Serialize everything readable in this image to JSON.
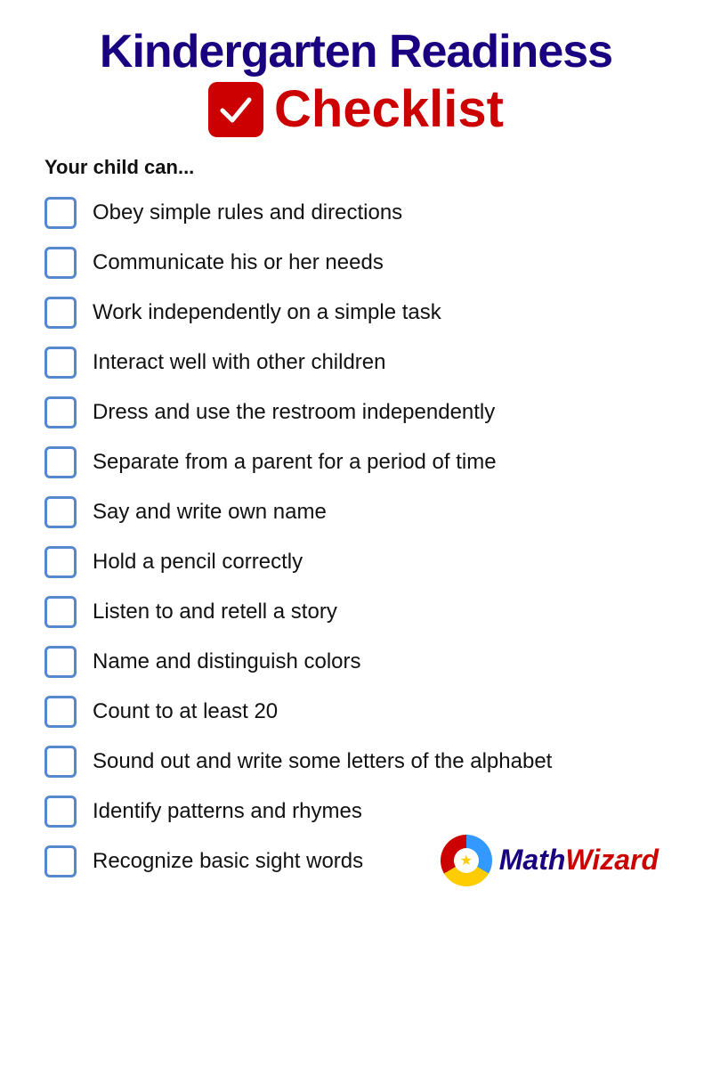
{
  "header": {
    "line1": "Kindergarten Readiness",
    "line2_label": "Checklist"
  },
  "subtitle": "Your child can...",
  "items": [
    {
      "id": 1,
      "text": "Obey simple rules and directions"
    },
    {
      "id": 2,
      "text": "Communicate his or her needs"
    },
    {
      "id": 3,
      "text": "Work independently on a simple task"
    },
    {
      "id": 4,
      "text": "Interact well with other children"
    },
    {
      "id": 5,
      "text": "Dress and use the restroom independently"
    },
    {
      "id": 6,
      "text": "Separate from a parent for a period of time"
    },
    {
      "id": 7,
      "text": "Say and write own name"
    },
    {
      "id": 8,
      "text": "Hold a pencil correctly"
    },
    {
      "id": 9,
      "text": "Listen to and retell a story"
    },
    {
      "id": 10,
      "text": "Name and distinguish colors"
    },
    {
      "id": 11,
      "text": "Count to at least 20"
    },
    {
      "id": 12,
      "text": "Sound out and write some letters of the alphabet"
    },
    {
      "id": 13,
      "text": "Identify patterns and rhymes"
    },
    {
      "id": 14,
      "text": "Recognize basic sight words"
    }
  ],
  "footer": {
    "logo_math": "Math",
    "logo_wizard": "Wizard"
  }
}
